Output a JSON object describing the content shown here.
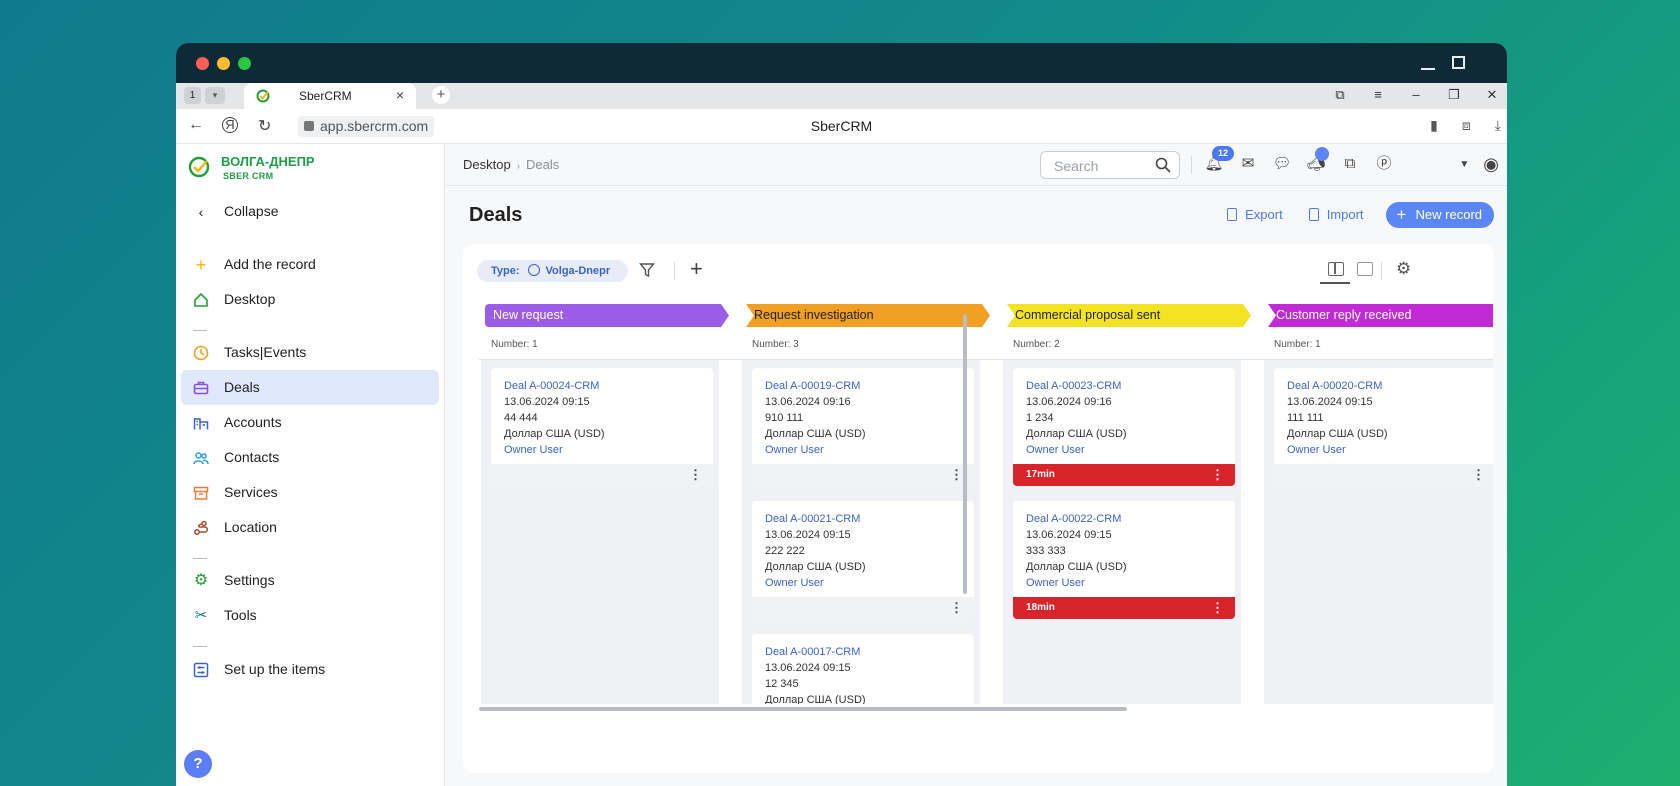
{
  "browser": {
    "tab_count": "1",
    "tab_title": "SberCRM",
    "url": "app.sbercrm.com",
    "page_title": "SberCRM"
  },
  "brand": {
    "name_line1": "ВОЛГА-ДНЕПР",
    "name_line2": "SBER CRM",
    "accent": "#1f9d4a"
  },
  "sidebar": {
    "collapse": "Collapse",
    "items": [
      {
        "label": "Add the record",
        "icon": "plus-icon"
      },
      {
        "label": "Desktop",
        "icon": "home-icon"
      },
      {
        "label": "Tasks|Events",
        "icon": "clock-icon"
      },
      {
        "label": "Deals",
        "icon": "briefcase-icon",
        "active": true
      },
      {
        "label": "Accounts",
        "icon": "building-icon"
      },
      {
        "label": "Contacts",
        "icon": "people-icon"
      },
      {
        "label": "Services",
        "icon": "box-icon"
      },
      {
        "label": "Location",
        "icon": "route-icon"
      },
      {
        "label": "Settings",
        "icon": "gear-icon"
      },
      {
        "label": "Tools",
        "icon": "tools-icon"
      },
      {
        "label": "Set up the items",
        "icon": "sliders-icon"
      }
    ],
    "help": "?"
  },
  "header": {
    "breadcrumb": [
      "Desktop",
      "Deals"
    ],
    "search_placeholder": "Search",
    "notifications_count": "12"
  },
  "page": {
    "title": "Deals",
    "export_label": "Export",
    "import_label": "Import",
    "new_record_label": "New record"
  },
  "filter": {
    "type_label": "Type:",
    "type_value": "Volga-Dnepr"
  },
  "kanban": {
    "columns": [
      {
        "stage": "New request",
        "color": "#9b5de5",
        "text_color": "#ffffff",
        "count": "Number: 1",
        "cards": [
          {
            "deal": "Deal A-00024-CRM",
            "date": "13.06.2024 09:15",
            "amount": "44 444",
            "currency": "Доллар США (USD)",
            "owner": "Owner User",
            "timer": ""
          }
        ]
      },
      {
        "stage": "Request investigation",
        "color": "#f2a024",
        "text_color": "#222222",
        "count": "Number: 3",
        "cards": [
          {
            "deal": "Deal A-00019-CRM",
            "date": "13.06.2024 09:16",
            "amount": "910 111",
            "currency": "Доллар США (USD)",
            "owner": "Owner User",
            "timer": ""
          },
          {
            "deal": "Deal A-00021-CRM",
            "date": "13.06.2024 09:15",
            "amount": "222 222",
            "currency": "Доллар США (USD)",
            "owner": "Owner User",
            "timer": ""
          },
          {
            "deal": "Deal A-00017-CRM",
            "date": "13.06.2024 09:15",
            "amount": "12 345",
            "currency": "Доллар США (USD)",
            "owner": "",
            "timer": ""
          }
        ]
      },
      {
        "stage": "Commercial proposal sent",
        "color": "#f4e322",
        "text_color": "#222222",
        "count": "Number: 2",
        "cards": [
          {
            "deal": "Deal A-00023-CRM",
            "date": "13.06.2024 09:16",
            "amount": "1 234",
            "currency": "Доллар США (USD)",
            "owner": "Owner User",
            "timer": "17min"
          },
          {
            "deal": "Deal A-00022-CRM",
            "date": "13.06.2024 09:15",
            "amount": "333 333",
            "currency": "Доллар США (USD)",
            "owner": "Owner User",
            "timer": "18min"
          }
        ]
      },
      {
        "stage": "Customer reply received",
        "color": "#c02bd6",
        "text_color": "#ffffff",
        "count": "Number: 1",
        "cards": [
          {
            "deal": "Deal A-00020-CRM",
            "date": "13.06.2024 09:15",
            "amount": "111 111",
            "currency": "Доллар США (USD)",
            "owner": "Owner User",
            "timer": ""
          }
        ]
      }
    ]
  }
}
